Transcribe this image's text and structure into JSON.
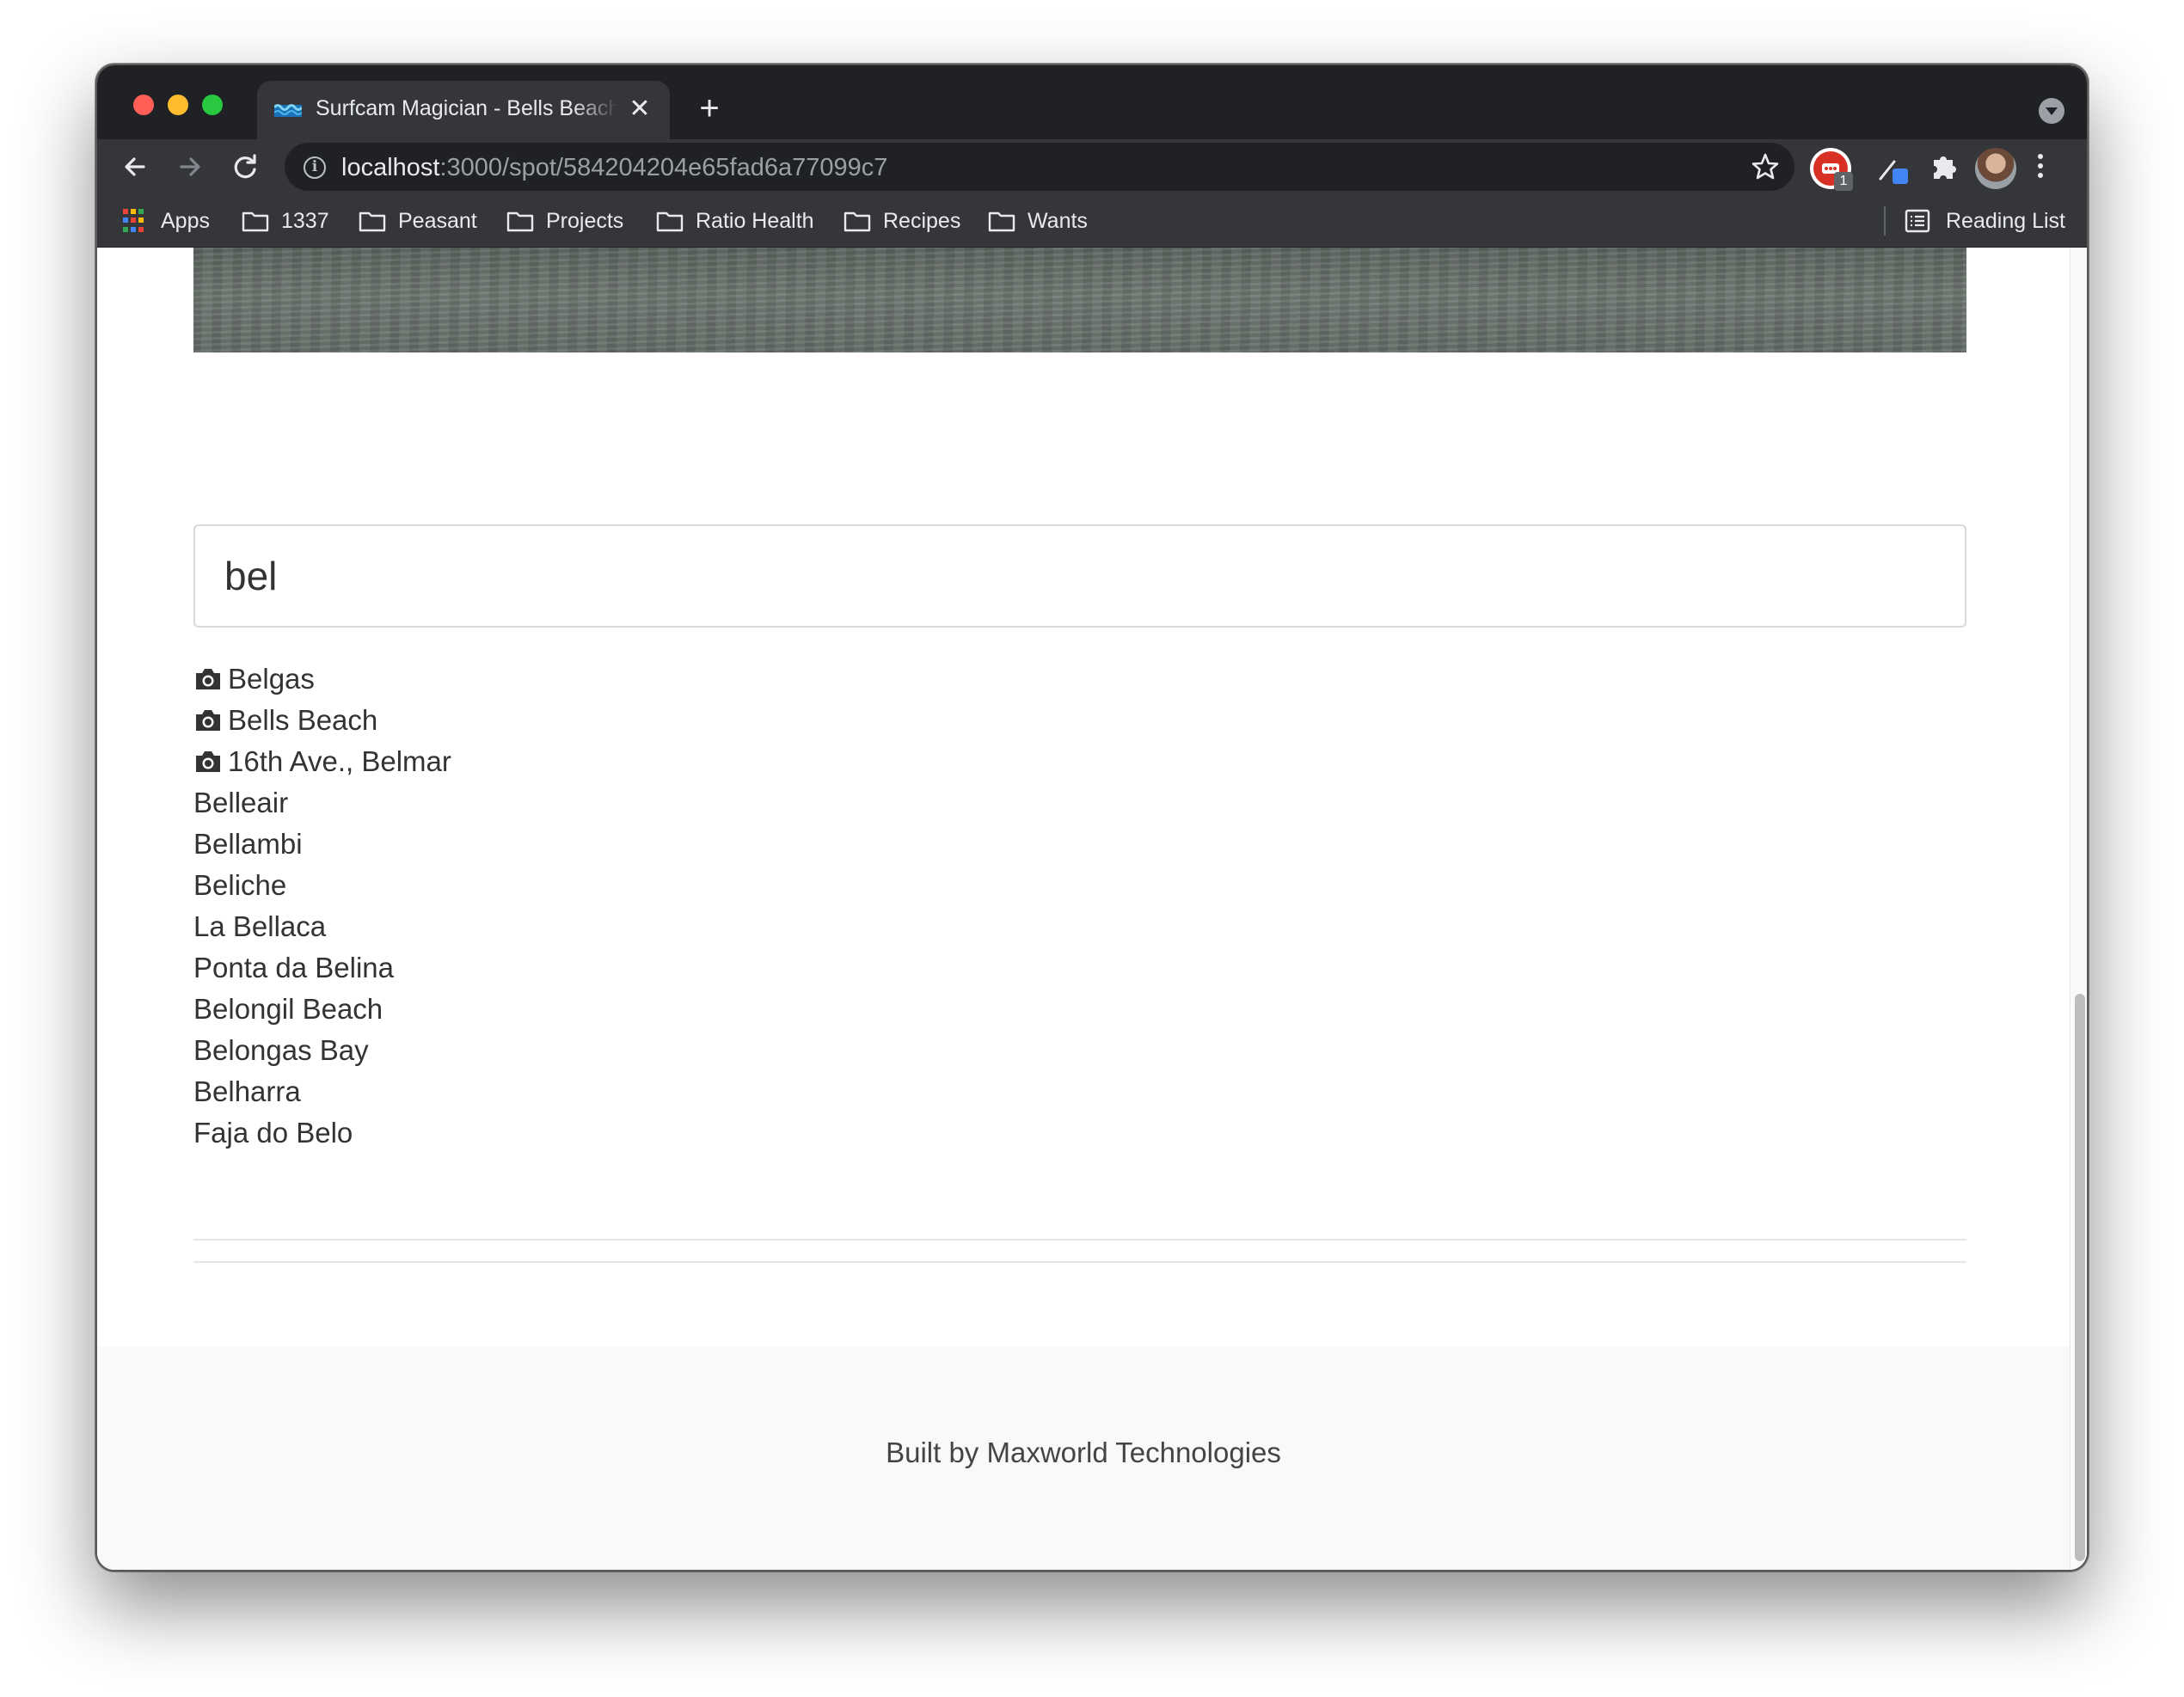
{
  "browser": {
    "tab": {
      "title": "Surfcam Magician - Bells Beach",
      "favicon": "wave-icon",
      "close_label": "✕"
    },
    "new_tab_label": "+",
    "address": {
      "host": "localhost",
      "path": ":3000/spot/584204204e65fad6a77099c7"
    },
    "extension_badge": "1",
    "bookmarks": [
      {
        "label": "Apps",
        "icon": "apps-grid-icon"
      },
      {
        "label": "1337",
        "icon": "folder-icon"
      },
      {
        "label": "Peasant",
        "icon": "folder-icon"
      },
      {
        "label": "Projects",
        "icon": "folder-icon"
      },
      {
        "label": "Ratio Health",
        "icon": "folder-icon"
      },
      {
        "label": "Recipes",
        "icon": "folder-icon"
      },
      {
        "label": "Wants",
        "icon": "folder-icon"
      }
    ],
    "reading_list_label": "Reading List"
  },
  "search": {
    "value": "bel"
  },
  "results": [
    {
      "label": "Belgas",
      "has_camera": true
    },
    {
      "label": "Bells Beach",
      "has_camera": true
    },
    {
      "label": "16th Ave., Belmar",
      "has_camera": true
    },
    {
      "label": "Belleair",
      "has_camera": false
    },
    {
      "label": "Bellambi",
      "has_camera": false
    },
    {
      "label": "Beliche",
      "has_camera": false
    },
    {
      "label": "La Bellaca",
      "has_camera": false
    },
    {
      "label": "Ponta da Belina",
      "has_camera": false
    },
    {
      "label": "Belongil Beach",
      "has_camera": false
    },
    {
      "label": "Belongas Bay",
      "has_camera": false
    },
    {
      "label": "Belharra",
      "has_camera": false
    },
    {
      "label": "Faja do Belo",
      "has_camera": false
    }
  ],
  "footer": {
    "text": "Built by Maxworld Technologies"
  },
  "colors": {
    "tabbar_bg": "#202124",
    "toolbar_bg": "#35363a",
    "text_primary": "#333333",
    "footer_bg": "#f9f9f9"
  }
}
